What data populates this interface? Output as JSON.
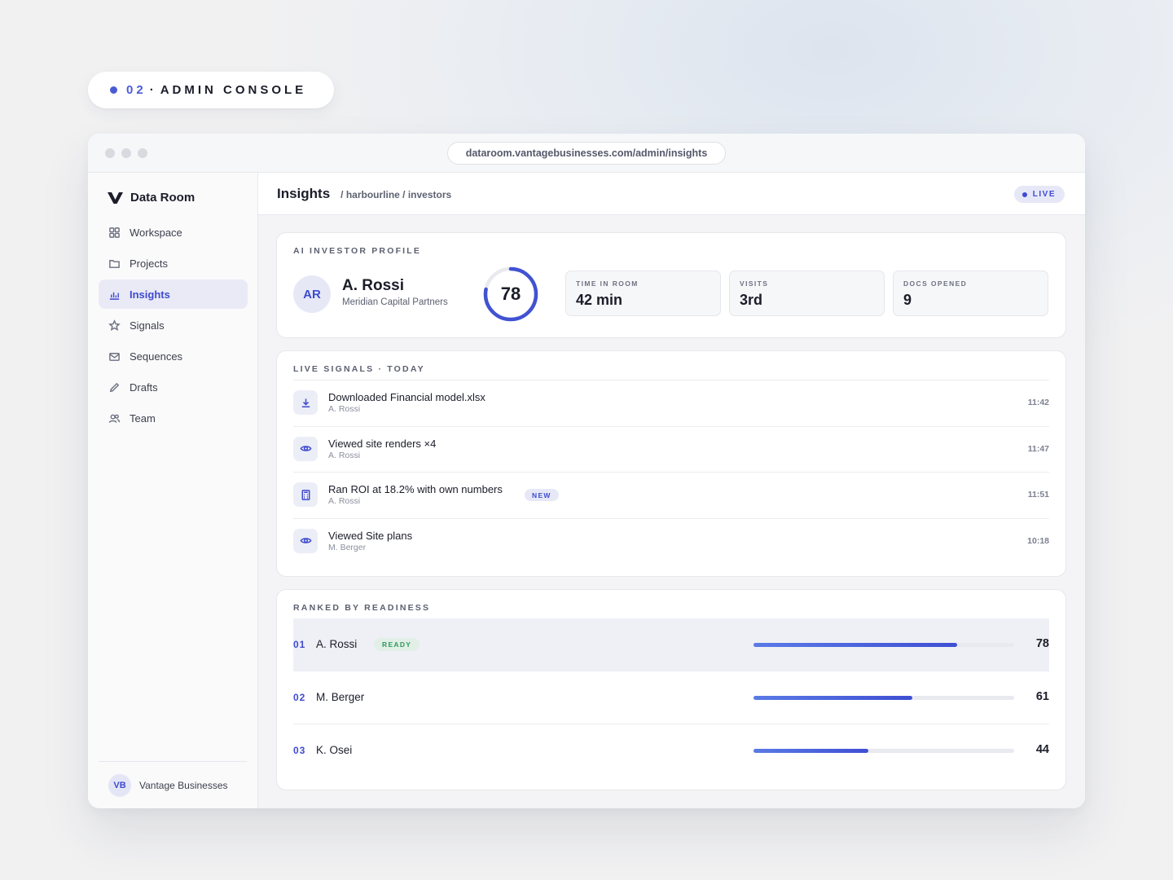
{
  "section_pill": {
    "number": "02",
    "separator": "·",
    "label": "ADMIN CONSOLE"
  },
  "browser": {
    "url": "dataroom.vantagebusinesses.com/admin/insights"
  },
  "sidebar": {
    "brand": "Data Room",
    "items": [
      {
        "label": "Workspace",
        "icon": "grid-icon",
        "active": false
      },
      {
        "label": "Projects",
        "icon": "folder-icon",
        "active": false
      },
      {
        "label": "Insights",
        "icon": "bar-chart-icon",
        "active": true
      },
      {
        "label": "Signals",
        "icon": "star-icon",
        "active": false
      },
      {
        "label": "Sequences",
        "icon": "mail-icon",
        "active": false
      },
      {
        "label": "Drafts",
        "icon": "pencil-icon",
        "active": false
      },
      {
        "label": "Team",
        "icon": "users-icon",
        "active": false
      }
    ],
    "footer": {
      "initials": "VB",
      "org": "Vantage Businesses"
    }
  },
  "header": {
    "title": "Insights",
    "breadcrumb": "/ harbourline / investors",
    "status": "LIVE"
  },
  "profile": {
    "label": "AI INVESTOR PROFILE",
    "initials": "AR",
    "name": "A. Rossi",
    "firm": "Meridian Capital Partners",
    "score": "78",
    "score_fraction": 0.78,
    "stats": [
      {
        "label": "TIME IN ROOM",
        "value": "42 min"
      },
      {
        "label": "VISITS",
        "value": "3rd"
      },
      {
        "label": "DOCS OPENED",
        "value": "9"
      }
    ]
  },
  "signals": {
    "label": "LIVE SIGNALS · TODAY",
    "items": [
      {
        "icon": "download-icon",
        "title": "Downloaded Financial model.xlsx",
        "who": "A. Rossi",
        "time": "11:42",
        "badge": ""
      },
      {
        "icon": "eye-icon",
        "title": "Viewed site renders ×4",
        "who": "A. Rossi",
        "time": "11:47",
        "badge": ""
      },
      {
        "icon": "calculator-icon",
        "title": "Ran ROI at 18.2% with own numbers",
        "who": "A. Rossi",
        "time": "11:51",
        "badge": "NEW"
      },
      {
        "icon": "eye-icon",
        "title": "Viewed Site plans",
        "who": "M. Berger",
        "time": "10:18",
        "badge": ""
      }
    ]
  },
  "ranked": {
    "label": "RANKED BY READINESS",
    "items": [
      {
        "rank": "01",
        "name": "A. Rossi",
        "badge": "READY",
        "score": "78",
        "fraction": 0.78,
        "highlight": true
      },
      {
        "rank": "02",
        "name": "M. Berger",
        "badge": "",
        "score": "61",
        "fraction": 0.61,
        "highlight": false
      },
      {
        "rank": "03",
        "name": "K. Osei",
        "badge": "",
        "score": "44",
        "fraction": 0.44,
        "highlight": false
      }
    ]
  },
  "colors": {
    "accent": "#3e4bd0",
    "ready": "#2e9a5b",
    "track": "#e9eaef"
  }
}
